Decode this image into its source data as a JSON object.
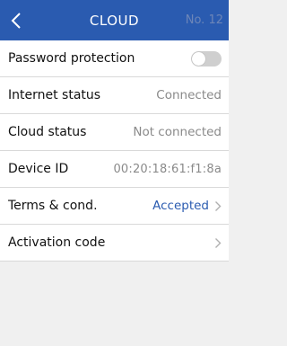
{
  "header": {
    "title": "CLOUD",
    "number": "No. 12",
    "back_icon": "chevron-left-icon"
  },
  "rows": [
    {
      "label": "Password protection",
      "toggle": {
        "on": false
      }
    },
    {
      "label": "Internet status",
      "value": "Connected"
    },
    {
      "label": "Cloud status",
      "value": "Not connected"
    },
    {
      "label": "Device ID",
      "value": "00:20:18:61:f1:8a"
    },
    {
      "label": "Terms & cond.",
      "value": "Accepted",
      "chevron_icon": "chevron-right-icon"
    },
    {
      "label": "Activation code",
      "chevron_icon": "chevron-right-icon"
    }
  ],
  "colors": {
    "header_bg": "#2a5bb0",
    "accent": "#2a5bb0",
    "muted_text": "#8a8a8a",
    "background": "#f0f0f0"
  }
}
